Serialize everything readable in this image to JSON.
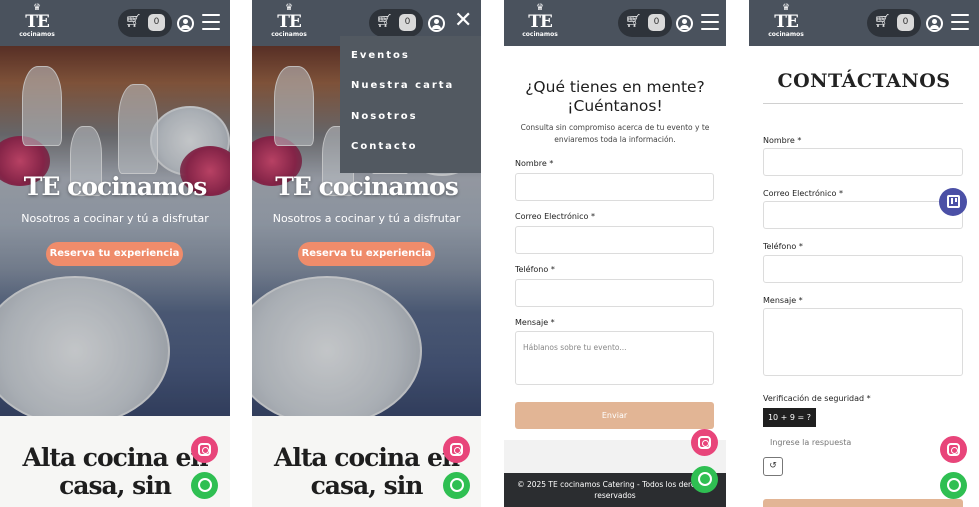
{
  "brand": {
    "logo_top": "TE",
    "logo_bottom": "cocinamos"
  },
  "cart": {
    "count": "0"
  },
  "hero": {
    "title": "TE cocinamos",
    "subtitle": "Nosotros a cocinar y tú a disfrutar",
    "cta_label": "Reserva tu experiencia"
  },
  "section": {
    "title_line1": "Alta cocina en",
    "title_line2": "casa, sin"
  },
  "menu": {
    "items": [
      "Eventos",
      "Nuestra carta",
      "Nosotros",
      "Contacto"
    ]
  },
  "contact_form_a": {
    "title_line1": "¿Qué tienes en mente?",
    "title_line2": "¡Cuéntanos!",
    "description": "Consulta sin compromiso acerca de tu evento y te enviaremos toda la información.",
    "name_label": "Nombre *",
    "email_label": "Correo Electrónico *",
    "phone_label": "Teléfono *",
    "message_label": "Mensaje *",
    "message_placeholder": "Háblanos sobre tu evento...",
    "submit_label": "Enviar",
    "footer_text": "© 2025 TE cocinamos Catering - Todos los derechos reservados"
  },
  "contact_form_b": {
    "title": "CONTÁCTANOS",
    "name_label": "Nombre *",
    "email_label": "Correo Electrónico *",
    "phone_label": "Teléfono *",
    "message_label": "Mensaje *",
    "captcha_label": "Verificación de seguridad *",
    "captcha_question": "10 + 9 = ?",
    "answer_placeholder": "Ingrese la respuesta",
    "refresh_symbol": "↺"
  },
  "colors": {
    "header": "#4a525d",
    "accent_orange": "#ef8c6b",
    "button_tan": "#e2b595",
    "instagram": "#e8457a",
    "whatsapp": "#2fbf52"
  },
  "icons": [
    "cart-icon",
    "user-icon",
    "hamburger-icon",
    "close-icon",
    "instagram-icon",
    "whatsapp-icon",
    "trello-icon",
    "refresh-icon"
  ]
}
